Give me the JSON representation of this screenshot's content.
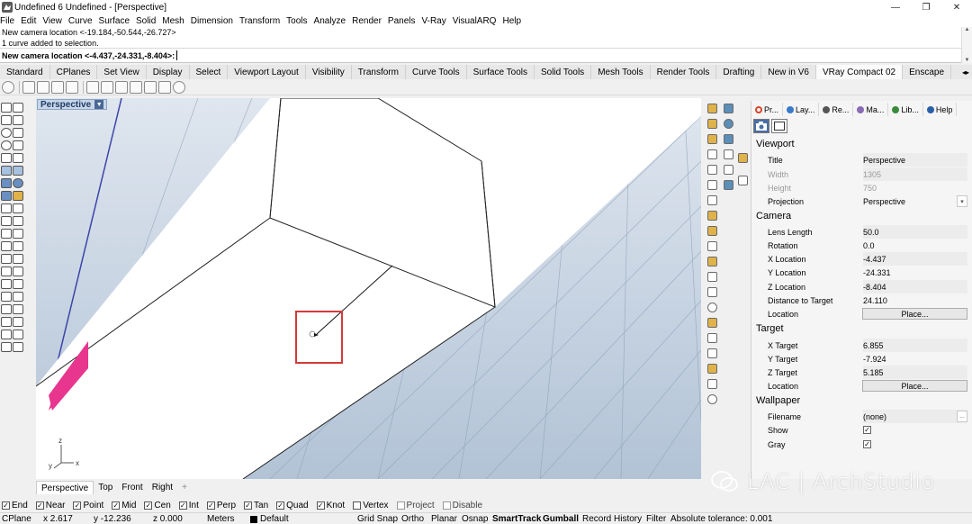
{
  "window": {
    "title": "Undefined 6 Undefined - [Perspective]",
    "buttons": [
      "—",
      "❐",
      "✕"
    ]
  },
  "menu": [
    "File",
    "Edit",
    "View",
    "Curve",
    "Surface",
    "Solid",
    "Mesh",
    "Dimension",
    "Transform",
    "Tools",
    "Analyze",
    "Render",
    "Panels",
    "V-Ray",
    "VisualARQ",
    "Help"
  ],
  "command": {
    "history": [
      "New camera location <-19.184,-50.544,-26.727>",
      "1 curve added to selection."
    ],
    "prompt": "New camera location <-4.437,-24.331,-8.404>:"
  },
  "toolbar_tabs": [
    "Standard",
    "CPlanes",
    "Set View",
    "Display",
    "Select",
    "Viewport Layout",
    "Visibility",
    "Transform",
    "Curve Tools",
    "Surface Tools",
    "Solid Tools",
    "Mesh Tools",
    "Render Tools",
    "Drafting",
    "New in V6",
    "VRay Compact 02",
    "Enscape"
  ],
  "active_toolbar_tab": "VRay Compact 02",
  "viewport": {
    "name": "Perspective",
    "axis_x": "x",
    "axis_y": "y",
    "axis_z": "z",
    "background_top": "#dfe6ef",
    "background_bottom": "#b2c3d6",
    "highlight_color": "#d43a3a",
    "accent_shape_color": "#e8358e"
  },
  "view_tabs": [
    "Perspective",
    "Top",
    "Front",
    "Right"
  ],
  "view_tab_add": "+",
  "panel": {
    "tabs": [
      {
        "label": "Pr...",
        "color": "#d9452b"
      },
      {
        "label": "Lay...",
        "color": "#3a78c9"
      },
      {
        "label": "Re...",
        "color": "#555555"
      },
      {
        "label": "Ma...",
        "color": "#8a6bb5"
      },
      {
        "label": "Lib...",
        "color": "#3a8a3a"
      },
      {
        "label": "Help",
        "color": "#2a5fa8"
      }
    ],
    "viewport": {
      "heading": "Viewport",
      "title_label": "Title",
      "title_value": "Perspective",
      "width_label": "Width",
      "width_value": "1305",
      "height_label": "Height",
      "height_value": "750",
      "projection_label": "Projection",
      "projection_value": "Perspective"
    },
    "camera": {
      "heading": "Camera",
      "lens_label": "Lens Length",
      "lens_value": "50.0",
      "rotation_label": "Rotation",
      "rotation_value": "0.0",
      "x_label": "X Location",
      "x_value": "-4.437",
      "y_label": "Y Location",
      "y_value": "-24.331",
      "z_label": "Z Location",
      "z_value": "-8.404",
      "dist_label": "Distance to Target",
      "dist_value": "24.110",
      "location_label": "Location",
      "place_button": "Place..."
    },
    "target": {
      "heading": "Target",
      "x_label": "X Target",
      "x_value": "6.855",
      "y_label": "Y Target",
      "y_value": "-7.924",
      "z_label": "Z Target",
      "z_value": "5.185",
      "location_label": "Location",
      "place_button": "Place..."
    },
    "wallpaper": {
      "heading": "Wallpaper",
      "filename_label": "Filename",
      "filename_value": "(none)",
      "browse_label": "...",
      "show_label": "Show",
      "show_checked": true,
      "gray_label": "Gray",
      "gray_checked": true
    }
  },
  "watermark": "LAC | ArchStudio",
  "osnaps": [
    {
      "label": "End",
      "checked": true
    },
    {
      "label": "Near",
      "checked": true
    },
    {
      "label": "Point",
      "checked": true
    },
    {
      "label": "Mid",
      "checked": true
    },
    {
      "label": "Cen",
      "checked": true
    },
    {
      "label": "Int",
      "checked": true
    },
    {
      "label": "Perp",
      "checked": true
    },
    {
      "label": "Tan",
      "checked": true
    },
    {
      "label": "Quad",
      "checked": true
    },
    {
      "label": "Knot",
      "checked": true
    },
    {
      "label": "Vertex",
      "checked": false
    },
    {
      "label": "Project",
      "checked": false
    },
    {
      "label": "Disable",
      "checked": false
    }
  ],
  "status": {
    "cplane": "CPlane",
    "x": "x 2.617",
    "y": "y -12.236",
    "z": "z 0.000",
    "units": "Meters",
    "layer": "Default",
    "grid_snap": "Grid Snap",
    "ortho": "Ortho",
    "planar": "Planar",
    "osnap": "Osnap",
    "smarttrack": "SmartTrack",
    "gumball": "Gumball",
    "record_history": "Record History",
    "filter": "Filter",
    "tolerance": "Absolute tolerance: 0.001"
  }
}
